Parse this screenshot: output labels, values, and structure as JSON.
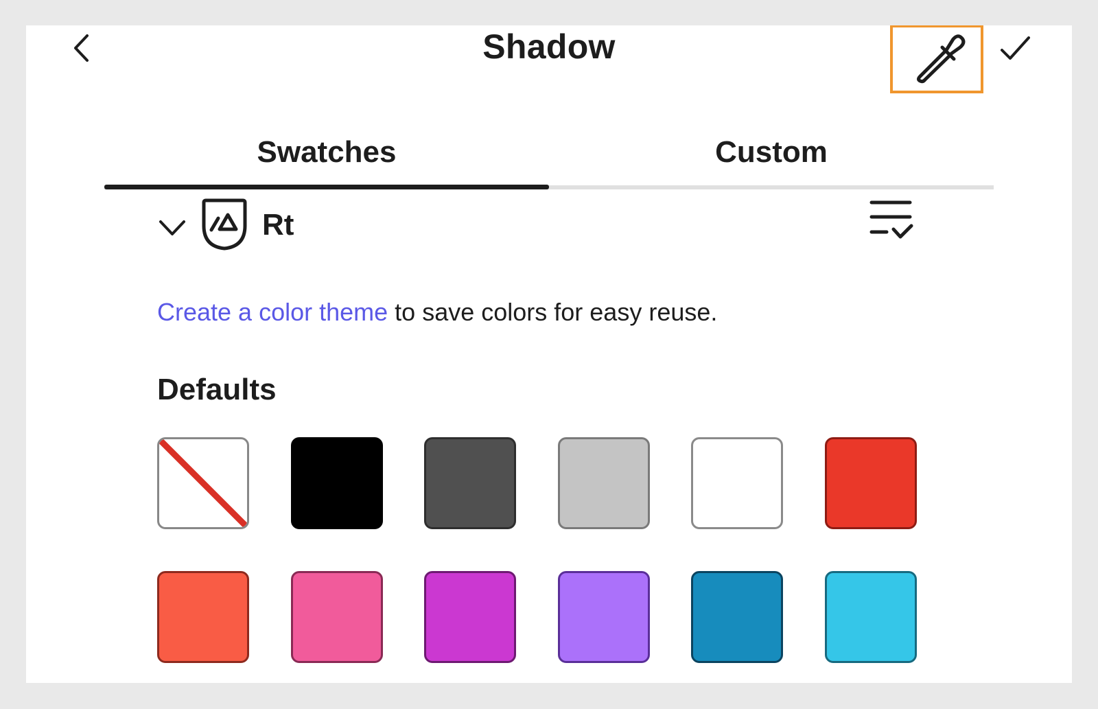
{
  "header": {
    "title": "Shadow",
    "back_icon": "chevron-left-icon",
    "eyedropper_icon": "eyedropper-icon",
    "done_icon": "checkmark-icon",
    "highlight_color": "#f0962e"
  },
  "tabs": [
    {
      "label": "Swatches",
      "selected": true
    },
    {
      "label": "Custom",
      "selected": false
    }
  ],
  "library": {
    "name": "Rt",
    "expand_icon": "chevron-down-icon",
    "library_icon": "creative-cloud-library-icon",
    "sort_icon": "sort-list-icon"
  },
  "info": {
    "link_text": "Create a color theme",
    "rest_text": " to save colors for easy reuse.",
    "link_color": "#5a58e6"
  },
  "defaults": {
    "title": "Defaults",
    "swatches": [
      {
        "name": "none",
        "fill": "#ffffff",
        "border": "#888888"
      },
      {
        "name": "black",
        "fill": "#000000",
        "border": "#000000"
      },
      {
        "name": "dark-gray",
        "fill": "#505050",
        "border": "#2e2e2e"
      },
      {
        "name": "light-gray",
        "fill": "#c4c4c4",
        "border": "#7a7a7a"
      },
      {
        "name": "white",
        "fill": "#ffffff",
        "border": "#8a8a8a"
      },
      {
        "name": "red",
        "fill": "#ea3829",
        "border": "#8e1c14"
      },
      {
        "name": "orange",
        "fill": "#f95c45",
        "border": "#8e2a1e"
      },
      {
        "name": "pink",
        "fill": "#f15b9b",
        "border": "#8a2a55"
      },
      {
        "name": "magenta",
        "fill": "#cb38d1",
        "border": "#6e1a72"
      },
      {
        "name": "purple",
        "fill": "#ab71fa",
        "border": "#5a2f99"
      },
      {
        "name": "blue",
        "fill": "#178cbd",
        "border": "#0b4460"
      },
      {
        "name": "cyan",
        "fill": "#35c6e8",
        "border": "#176a80"
      }
    ]
  }
}
